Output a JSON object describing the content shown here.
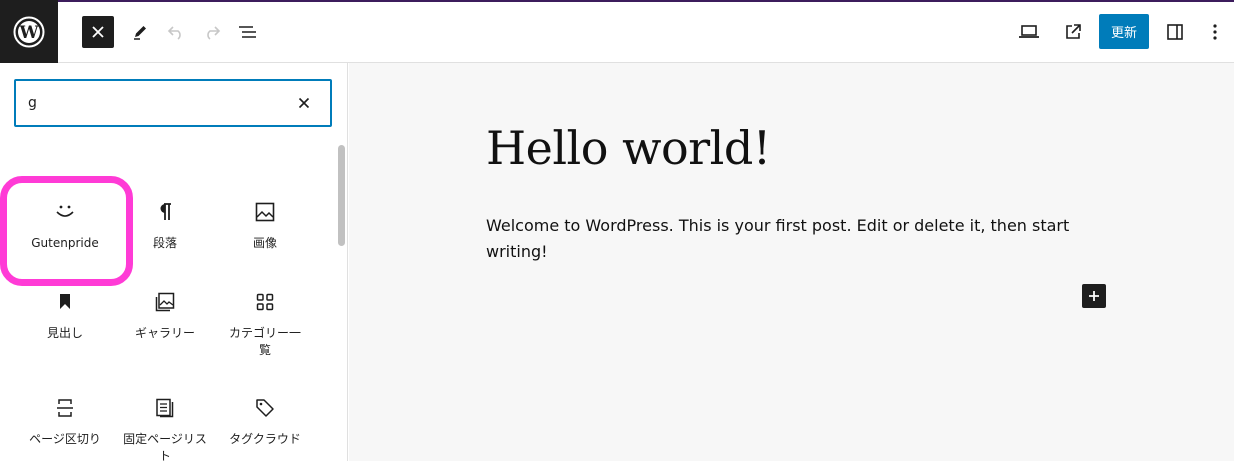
{
  "header": {
    "update_label": "更新",
    "accent_color": "#007cba",
    "icons": [
      "wordpress-logo",
      "close-icon",
      "pencil-icon",
      "undo-icon",
      "redo-icon",
      "list-view-icon",
      "desktop-icon",
      "external-link-icon",
      "sidebar-icon",
      "more-vertical-icon"
    ]
  },
  "inserter": {
    "search_value": "g",
    "blocks": [
      {
        "label": "Gutenpride",
        "icon": "smiley-icon"
      },
      {
        "label": "段落",
        "icon": "paragraph-icon"
      },
      {
        "label": "画像",
        "icon": "image-icon"
      },
      {
        "label": "見出し",
        "icon": "bookmark-icon"
      },
      {
        "label": "ギャラリー",
        "icon": "gallery-icon"
      },
      {
        "label": "カテゴリー一覧",
        "icon": "grid-icon"
      },
      {
        "label": "ページ区切り",
        "icon": "page-break-icon"
      },
      {
        "label": "固定ページリスト",
        "icon": "page-list-icon"
      },
      {
        "label": "タグクラウド",
        "icon": "tag-icon"
      }
    ],
    "highlight_color": "#ff3bd6"
  },
  "post": {
    "title": "Hello world!",
    "content": "Welcome to WordPress. This is your first post. Edit or delete it, then start writing!"
  }
}
